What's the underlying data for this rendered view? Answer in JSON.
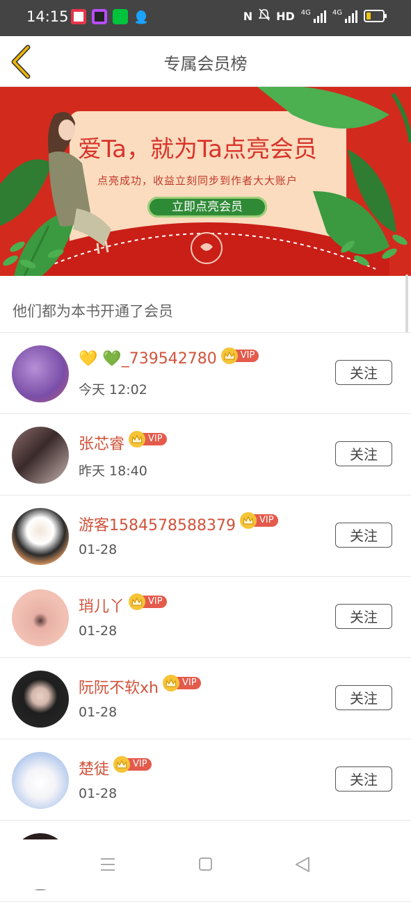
{
  "status_bar": {
    "time": "14:15",
    "network_label": "HD",
    "signal_1": "4G",
    "signal_2": "4G"
  },
  "header": {
    "title": "专属会员榜",
    "back_icon": "chevron-left-icon",
    "accent": "#f2b705"
  },
  "banner": {
    "headline": "爱Ta，就为Ta点亮会员",
    "subtitle": "点亮成功，收益立刻同步到作者大大账户",
    "button_label": "立即点亮会员",
    "background_color": "#d32a1e"
  },
  "section": {
    "heading": "他们都为本书开通了会员"
  },
  "vip_label": "VIP",
  "follow_label": "关注",
  "members": [
    {
      "name": "💛 💚_739542780",
      "time": "今天 12:02"
    },
    {
      "name": "张芯睿",
      "time": "昨天 18:40"
    },
    {
      "name": "游客1584578588379",
      "time": "01-28"
    },
    {
      "name": "琑儿丫",
      "time": "01-28"
    },
    {
      "name": "阮阮不软xh",
      "time": "01-28"
    },
    {
      "name": "楚徒",
      "time": "01-28"
    },
    {
      "name": "",
      "time": ""
    }
  ],
  "nav": {
    "menu_icon": "menu-icon",
    "home_icon": "home-square-icon",
    "back_icon": "back-triangle-icon"
  }
}
